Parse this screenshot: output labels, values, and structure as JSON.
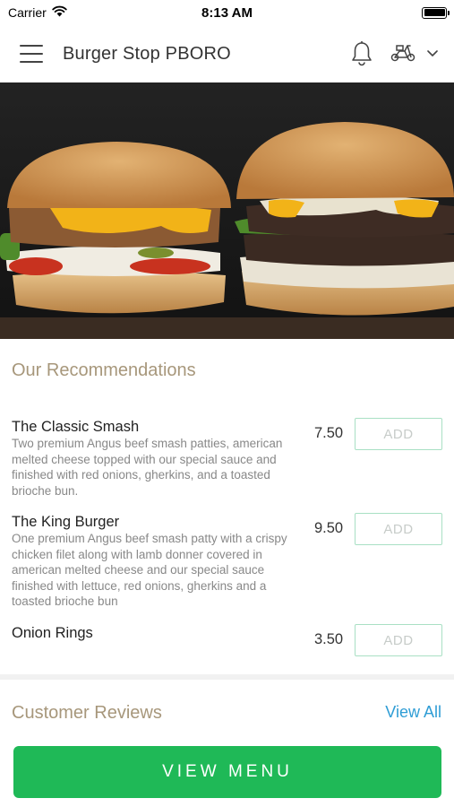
{
  "status_bar": {
    "carrier": "Carrier",
    "time": "8:13 AM"
  },
  "header": {
    "title": "Burger Stop PBORO",
    "icons": [
      "menu-icon",
      "bell-icon",
      "scooter-icon",
      "chevron-down-icon"
    ]
  },
  "recommendations": {
    "title": "Our Recommendations",
    "items": [
      {
        "name": "The Classic Smash",
        "description": "Two premium Angus beef smash patties, american melted cheese topped with our special sauce and finished with red onions, gherkins, and a toasted brioche bun.",
        "price": "7.50",
        "add_label": "ADD"
      },
      {
        "name": "The King Burger",
        "description": "One premium Angus beef smash patty with a crispy chicken filet along with lamb donner covered in american melted cheese and our special sauce finished with lettuce, red onions, gherkins and a toasted brioche bun",
        "price": "9.50",
        "add_label": "ADD"
      },
      {
        "name": "Onion Rings",
        "description": "",
        "price": "3.50",
        "add_label": "ADD"
      }
    ]
  },
  "reviews": {
    "title": "Customer Reviews",
    "view_all": "View All"
  },
  "cta": {
    "label": "VIEW MENU"
  },
  "colors": {
    "accent_green": "#1fb957",
    "section_title": "#a7977b",
    "link_blue": "#2f9dd5",
    "add_border": "#a9e0c4"
  }
}
